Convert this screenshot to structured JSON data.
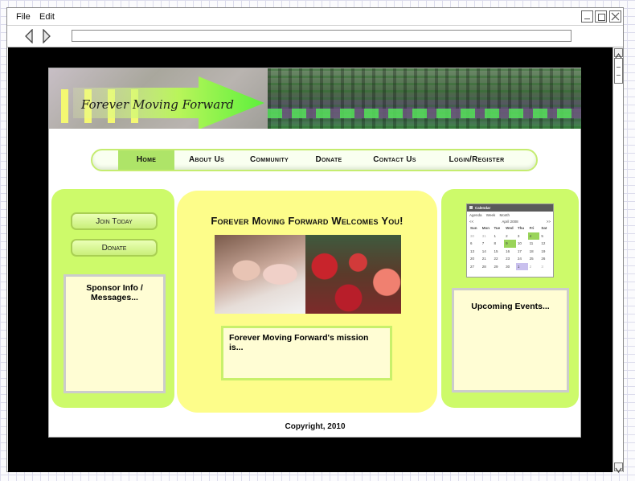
{
  "menubar": {
    "file": "File",
    "edit": "Edit"
  },
  "address": {
    "url": ""
  },
  "banner": {
    "title": "Forever Moving Forward"
  },
  "nav": {
    "items": [
      "Home",
      "About Us",
      "Community",
      "Donate",
      "Contact Us",
      "Login/Register"
    ],
    "active": "Home"
  },
  "left_sidebar": {
    "join_label": "Join Today",
    "donate_label": "Donate",
    "sponsor_text": "Sponsor Info / Messages..."
  },
  "center": {
    "welcome": "Forever Moving Forward Welcomes You!",
    "mission": "Forever Moving Forward's mission is..."
  },
  "calendar": {
    "title": "Calendar",
    "tabs": [
      "Agenda",
      "Week",
      "Month"
    ],
    "month_label": "April 2008",
    "prev": "<<",
    "next": ">>",
    "weekdays": [
      "Sun",
      "Mon",
      "Tue",
      "Wed",
      "Thu",
      "Fri",
      "Sat"
    ],
    "weeks": [
      [
        "30",
        "31",
        "1",
        "2",
        "3",
        "4",
        "5"
      ],
      [
        "6",
        "7",
        "8",
        "9",
        "10",
        "11",
        "12"
      ],
      [
        "13",
        "14",
        "15",
        "16",
        "17",
        "18",
        "19"
      ],
      [
        "20",
        "21",
        "22",
        "23",
        "24",
        "25",
        "26"
      ],
      [
        "27",
        "28",
        "29",
        "30",
        "1",
        "2",
        "3"
      ]
    ]
  },
  "right_sidebar": {
    "events_text": "Upcoming Events..."
  },
  "footer": {
    "copyright": "Copyright, 2010"
  },
  "colors": {
    "accent_green": "#cdfa6a",
    "center_yellow": "#fdfd8a",
    "box_fill": "#fffdd4",
    "nav_active": "#aee468"
  }
}
